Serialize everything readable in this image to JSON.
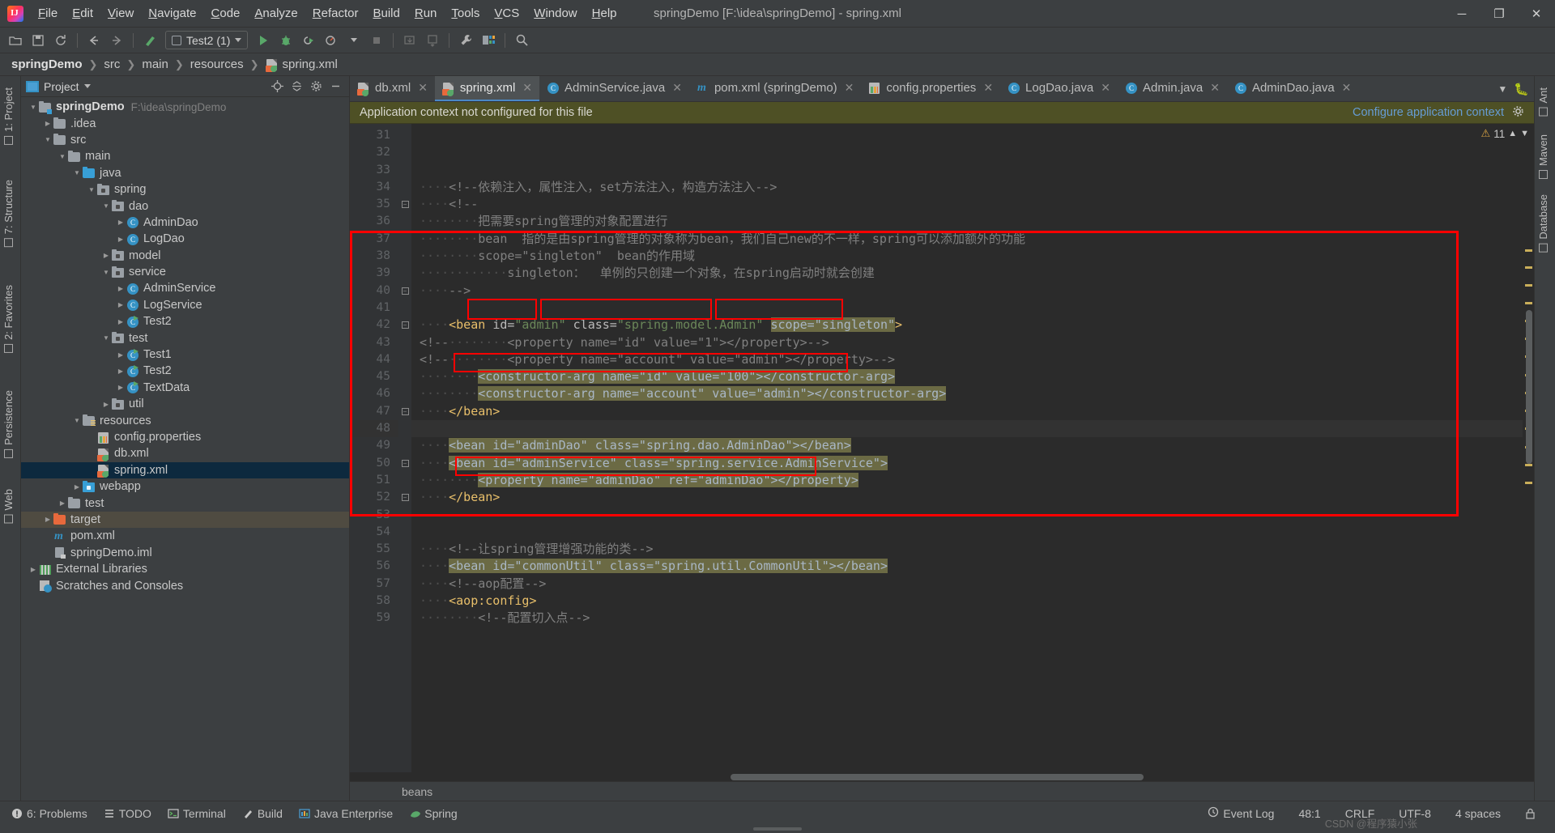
{
  "window": {
    "title": "springDemo [F:\\idea\\springDemo] - spring.xml",
    "minimize": "─",
    "maximize": "❐",
    "close": "✕"
  },
  "menu": [
    {
      "label": "File"
    },
    {
      "label": "Edit"
    },
    {
      "label": "View"
    },
    {
      "label": "Navigate"
    },
    {
      "label": "Code"
    },
    {
      "label": "Analyze"
    },
    {
      "label": "Refactor"
    },
    {
      "label": "Build"
    },
    {
      "label": "Run"
    },
    {
      "label": "Tools"
    },
    {
      "label": "VCS"
    },
    {
      "label": "Window"
    },
    {
      "label": "Help"
    }
  ],
  "toolbar": {
    "open_icon": "open-folder-icon",
    "save_icon": "save-icon",
    "sync_icon": "sync-icon",
    "back_icon": "back-arrow-icon",
    "forward_icon": "forward-arrow-icon",
    "build_icon": "hammer-icon",
    "run_config": "Test2 (1)",
    "run_icon": "run-icon",
    "debug_icon": "debug-icon",
    "coverage_icon": "run-with-coverage-icon",
    "profile_icon": "profiler-icon",
    "stop_icon": "stop-icon",
    "update_icon": "update-project-icon",
    "commit_icon": "commit-icon",
    "settings_icon": "wrench-icon",
    "structure_icon": "project-structure-icon",
    "search_icon": "search-everywhere-icon"
  },
  "breadcrumb": [
    {
      "label": "springDemo",
      "bold": true
    },
    {
      "label": "src",
      "bold": false
    },
    {
      "label": "main",
      "bold": false
    },
    {
      "label": "resources",
      "bold": false
    },
    {
      "label": "spring.xml",
      "bold": false,
      "icon": "xml-spring-icon"
    }
  ],
  "left_rail": [
    {
      "label": "1: Project",
      "icon": "project-icon"
    },
    {
      "label": "7: Structure",
      "icon": "structure-icon"
    },
    {
      "label": "2: Favorites",
      "icon": "favorites-icon"
    },
    {
      "label": "Persistence",
      "icon": "persistence-icon"
    },
    {
      "label": "Web",
      "icon": "web-icon"
    }
  ],
  "right_rail": [
    {
      "label": "Ant",
      "icon": "ant-icon"
    },
    {
      "label": "Maven",
      "icon": "maven-icon"
    },
    {
      "label": "Database",
      "icon": "database-icon"
    }
  ],
  "project_panel": {
    "title": "Project",
    "dropdown_icon": "chevron-down-icon",
    "actions": [
      "locate-icon",
      "collapse-all-icon",
      "settings-gear-icon",
      "hide-icon"
    ],
    "tree": [
      {
        "depth": 0,
        "arrow": "v",
        "icon": "module-folder",
        "label": "springDemo",
        "bold": true,
        "path": "F:\\idea\\springDemo"
      },
      {
        "depth": 1,
        "arrow": ">",
        "icon": "folder-gray",
        "label": ".idea"
      },
      {
        "depth": 1,
        "arrow": "v",
        "icon": "folder-gray",
        "label": "src"
      },
      {
        "depth": 2,
        "arrow": "v",
        "icon": "folder-gray",
        "label": "main"
      },
      {
        "depth": 3,
        "arrow": "v",
        "icon": "folder-blue",
        "label": "java"
      },
      {
        "depth": 4,
        "arrow": "v",
        "icon": "package",
        "label": "spring"
      },
      {
        "depth": 5,
        "arrow": "v",
        "icon": "package",
        "label": "dao"
      },
      {
        "depth": 6,
        "arrow": ">",
        "icon": "class",
        "label": "AdminDao"
      },
      {
        "depth": 6,
        "arrow": ">",
        "icon": "class",
        "label": "LogDao"
      },
      {
        "depth": 5,
        "arrow": ">",
        "icon": "package",
        "label": "model"
      },
      {
        "depth": 5,
        "arrow": "v",
        "icon": "package",
        "label": "service"
      },
      {
        "depth": 6,
        "arrow": ">",
        "icon": "class",
        "label": "AdminService"
      },
      {
        "depth": 6,
        "arrow": ">",
        "icon": "class",
        "label": "LogService"
      },
      {
        "depth": 6,
        "arrow": ">",
        "icon": "class-runnable",
        "label": "Test2"
      },
      {
        "depth": 5,
        "arrow": "v",
        "icon": "package",
        "label": "test"
      },
      {
        "depth": 6,
        "arrow": ">",
        "icon": "class-runnable",
        "label": "Test1"
      },
      {
        "depth": 6,
        "arrow": ">",
        "icon": "class-runnable",
        "label": "Test2"
      },
      {
        "depth": 6,
        "arrow": ">",
        "icon": "class-runnable",
        "label": "TextData"
      },
      {
        "depth": 5,
        "arrow": ">",
        "icon": "package",
        "label": "util"
      },
      {
        "depth": 3,
        "arrow": "v",
        "icon": "folder-resources",
        "label": "resources"
      },
      {
        "depth": 4,
        "arrow": "",
        "icon": "properties",
        "label": "config.properties"
      },
      {
        "depth": 4,
        "arrow": "",
        "icon": "xml-spring",
        "label": "db.xml"
      },
      {
        "depth": 4,
        "arrow": "",
        "icon": "xml-spring",
        "label": "spring.xml",
        "selected": true
      },
      {
        "depth": 3,
        "arrow": ">",
        "icon": "package-web",
        "label": "webapp"
      },
      {
        "depth": 2,
        "arrow": ">",
        "icon": "folder-gray",
        "label": "test"
      },
      {
        "depth": 1,
        "arrow": ">",
        "icon": "folder-orange",
        "label": "target",
        "highlight": true
      },
      {
        "depth": 1,
        "arrow": "",
        "icon": "maven",
        "label": "pom.xml"
      },
      {
        "depth": 1,
        "arrow": "",
        "icon": "iml",
        "label": "springDemo.iml"
      },
      {
        "depth": 0,
        "arrow": ">",
        "icon": "ext-libraries",
        "label": "External Libraries"
      },
      {
        "depth": 0,
        "arrow": "",
        "icon": "scratches",
        "label": "Scratches and Consoles"
      }
    ]
  },
  "editor_tabs": [
    {
      "label": "db.xml",
      "icon": "xml-spring-icon",
      "active": false
    },
    {
      "label": "spring.xml",
      "icon": "xml-spring-icon",
      "active": true
    },
    {
      "label": "AdminService.java",
      "icon": "class-icon",
      "active": false
    },
    {
      "label": "pom.xml (springDemo)",
      "icon": "maven-icon",
      "active": false
    },
    {
      "label": "config.properties",
      "icon": "properties-icon",
      "active": false
    },
    {
      "label": "LogDao.java",
      "icon": "class-icon",
      "active": false
    },
    {
      "label": "Admin.java",
      "icon": "class-icon",
      "active": false
    },
    {
      "label": "AdminDao.java",
      "icon": "class-icon",
      "active": false
    }
  ],
  "tabs_overflow_icon": "chevron-down-icon",
  "notification": {
    "message": "Application context not configured for this file",
    "action": "Configure application context",
    "settings_icon": "gear-icon"
  },
  "inspection": {
    "count": "11",
    "warn_icon": "warning-triangle-icon",
    "up_icon": "chevron-up-icon",
    "down_icon": "chevron-down-icon"
  },
  "code": {
    "first_line": 31,
    "lines": [
      {
        "n": 31,
        "segments": []
      },
      {
        "n": 32,
        "segments": []
      },
      {
        "n": 33,
        "segments": []
      },
      {
        "n": 34,
        "segments": [
          {
            "t": "····",
            "c": "ws"
          },
          {
            "t": "<!--依赖注入，属性注入，set方法注入，构造方法注入-->",
            "c": "cmt"
          }
        ]
      },
      {
        "n": 35,
        "fold": "open",
        "segments": [
          {
            "t": "····",
            "c": "ws"
          },
          {
            "t": "<!--",
            "c": "cmt"
          }
        ]
      },
      {
        "n": 36,
        "segments": [
          {
            "t": "········",
            "c": "ws"
          },
          {
            "t": "把需要spring管理的对象配置进行",
            "c": "cmt"
          }
        ]
      },
      {
        "n": 37,
        "segments": [
          {
            "t": "········",
            "c": "ws"
          },
          {
            "t": "bean  指的是由spring管理的对象称为bean，我们自己new的不一样，spring可以添加额外的功能",
            "c": "cmt"
          }
        ]
      },
      {
        "n": 38,
        "segments": [
          {
            "t": "········",
            "c": "ws"
          },
          {
            "t": "scope=\"singleton\"  bean的作用域",
            "c": "cmt"
          }
        ]
      },
      {
        "n": 39,
        "segments": [
          {
            "t": "············",
            "c": "ws"
          },
          {
            "t": "singleton：  单例的只创建一个对象，在spring启动时就会创建",
            "c": "cmt"
          }
        ]
      },
      {
        "n": 40,
        "fold": "close",
        "segments": [
          {
            "t": "····",
            "c": "ws"
          },
          {
            "t": "-->",
            "c": "cmt"
          }
        ]
      },
      {
        "n": 41,
        "segments": []
      },
      {
        "n": 42,
        "fold": "open",
        "segments": [
          {
            "t": "····",
            "c": "ws"
          },
          {
            "t": "<bean",
            "c": "tag"
          },
          {
            "t": " ",
            "c": "ws"
          },
          {
            "t": "id=",
            "c": "attr",
            "box": "red"
          },
          {
            "t": "\"admin\"",
            "c": "str",
            "box": "red"
          },
          {
            "t": " ",
            "c": "ws"
          },
          {
            "t": "class=",
            "c": "attr",
            "box": "red"
          },
          {
            "t": "\"spring.model.Admin\"",
            "c": "str",
            "box": "red"
          },
          {
            "t": " ",
            "c": "ws"
          },
          {
            "t": "scope=",
            "c": "attr",
            "box": "redhl"
          },
          {
            "t": "\"singleton\"",
            "c": "str",
            "box": "redhl"
          },
          {
            "t": ">",
            "c": "tag"
          }
        ]
      },
      {
        "n": 43,
        "segments": [
          {
            "t": "<!--",
            "c": "cmt"
          },
          {
            "t": "········",
            "c": "ws"
          },
          {
            "t": "<property name=\"id\" value=\"1\"></property>-->",
            "c": "cmt"
          }
        ]
      },
      {
        "n": 44,
        "segments": [
          {
            "t": "<!--",
            "c": "cmt"
          },
          {
            "t": "········",
            "c": "ws"
          },
          {
            "t": "<property name=\"account\" value=\"admin\"></property>-->",
            "c": "cmt"
          }
        ]
      },
      {
        "n": 45,
        "segments": [
          {
            "t": "········",
            "c": "ws"
          },
          {
            "t": "<constructor-arg name=\"id\" value=\"100\"></constructor-arg>",
            "c": "hl",
            "box": "red"
          }
        ]
      },
      {
        "n": 46,
        "segments": [
          {
            "t": "········",
            "c": "ws"
          },
          {
            "t": "<constructor-arg name=\"account\" value=\"admin\"></constructor-arg>",
            "c": "hl"
          }
        ]
      },
      {
        "n": 47,
        "fold": "close",
        "bulb": true,
        "segments": [
          {
            "t": "····",
            "c": "ws"
          },
          {
            "t": "</bean>",
            "c": "tag"
          }
        ]
      },
      {
        "n": 48,
        "highlight": true,
        "segments": []
      },
      {
        "n": 49,
        "segments": [
          {
            "t": "····",
            "c": "ws"
          },
          {
            "t": "<bean id=\"adminDao\" class=\"spring.dao.AdminDao\"></bean>",
            "c": "hl"
          }
        ]
      },
      {
        "n": 50,
        "fold": "open",
        "segments": [
          {
            "t": "····",
            "c": "ws"
          },
          {
            "t": "<bean id=\"adminService\" class=\"spring.service.AdminService\">",
            "c": "hl"
          }
        ]
      },
      {
        "n": 51,
        "segments": [
          {
            "t": "········",
            "c": "ws"
          },
          {
            "t": "<property name=\"adminDao\" ref=\"adminDao\"></property>",
            "c": "hl",
            "box": "red"
          }
        ]
      },
      {
        "n": 52,
        "fold": "close",
        "segments": [
          {
            "t": "····",
            "c": "ws"
          },
          {
            "t": "</bean>",
            "c": "tag"
          }
        ]
      },
      {
        "n": 53,
        "segments": []
      },
      {
        "n": 54,
        "segments": []
      },
      {
        "n": 55,
        "segments": [
          {
            "t": "····",
            "c": "ws"
          },
          {
            "t": "<!--让spring管理增强功能的类-->",
            "c": "cmt"
          }
        ]
      },
      {
        "n": 56,
        "segments": [
          {
            "t": "····",
            "c": "ws"
          },
          {
            "t": "<bean id=\"commonUtil\" class=\"spring.util.CommonUtil\"></bean>",
            "c": "hl"
          }
        ]
      },
      {
        "n": 57,
        "segments": [
          {
            "t": "····",
            "c": "ws"
          },
          {
            "t": "<!--aop配置-->",
            "c": "cmt"
          }
        ]
      },
      {
        "n": 58,
        "segments": [
          {
            "t": "····",
            "c": "ws"
          },
          {
            "t": "<aop:config>",
            "c": "tag"
          }
        ]
      },
      {
        "n": 59,
        "segments": [
          {
            "t": "········",
            "c": "ws"
          },
          {
            "t": "<!--配置切入点-->",
            "c": "cmt"
          }
        ]
      }
    ]
  },
  "breadcrumb_bottom": "beans",
  "status_bar": {
    "left": [
      {
        "label": "6: Problems",
        "icon": "problems-icon"
      },
      {
        "label": "TODO",
        "icon": "todo-icon"
      },
      {
        "label": "Terminal",
        "icon": "terminal-icon"
      },
      {
        "label": "Build",
        "icon": "build-icon"
      },
      {
        "label": "Java Enterprise",
        "icon": "java-enterprise-icon"
      },
      {
        "label": "Spring",
        "icon": "spring-icon"
      }
    ],
    "right": [
      {
        "label": "Event Log",
        "icon": "event-log-icon"
      }
    ],
    "caret": "48:1",
    "line_sep": "CRLF",
    "encoding": "UTF-8",
    "indent": "4 spaces",
    "lock_icon": "lock-icon",
    "watermark": "CSDN @程序猿小张"
  },
  "colors": {
    "accent": "#4a88c7",
    "panel": "#3c3f41",
    "editor_bg": "#2b2b2b",
    "gutter": "#313335",
    "selection": "#0d293e",
    "notification": "#4e5025",
    "highlight_box": "#6b6a44",
    "redbox": "#ff0000",
    "string": "#6a8759",
    "tag": "#e8bf6a",
    "comment": "#808080"
  }
}
